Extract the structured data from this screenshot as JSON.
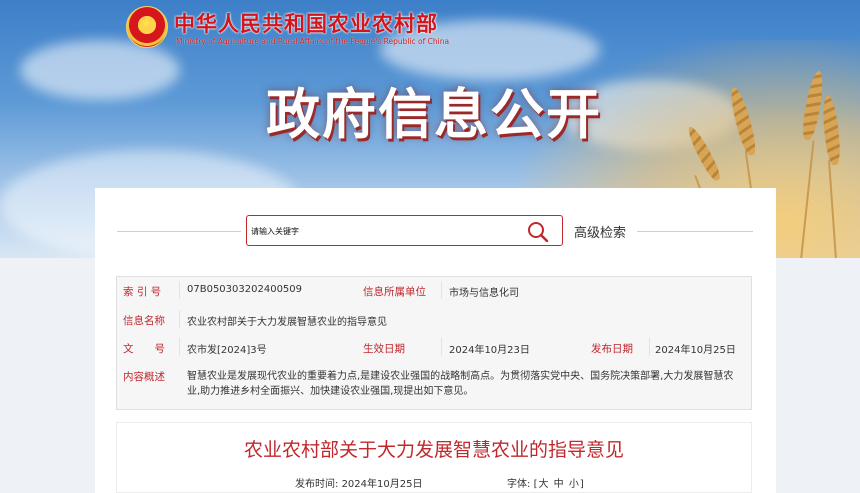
{
  "header": {
    "ministry_name_cn": "中华人民共和国农业农村部",
    "ministry_name_en": "Ministry of Agriculture and Rural Affairs of the People's Republic of China",
    "banner_title": "政府信息公开"
  },
  "search": {
    "placeholder": "请输入关键字",
    "advanced_label": "高级检索",
    "icon": "search-icon"
  },
  "info": {
    "index_label": "索 引 号",
    "index_value": "07B050303202400509",
    "dept_label": "信息所属单位",
    "dept_value": "市场与信息化司",
    "name_label": "信息名称",
    "name_value": "农业农村部关于大力发展智慧农业的指导意见",
    "doc_label": "文　　号",
    "doc_value": "农市发[2024]3号",
    "effective_label": "生效日期",
    "effective_value": "2024年10月23日",
    "issued_label": "发布日期",
    "issued_value": "2024年10月25日",
    "summary_label": "内容概述",
    "summary_value": "智慧农业是发展现代农业的重要着力点,是建设农业强国的战略制高点。为贯彻落实党中央、国务院决策部署,大力发展智慧农业,助力推进乡村全面振兴、加快建设农业强国,现提出如下意见。"
  },
  "article": {
    "title": "农业农村部关于大力发展智慧农业的指导意见",
    "publish_time_label": "发布时间:",
    "publish_time": "2024年10月25日",
    "font_label": "字体:",
    "font_open": "[",
    "font_large": "大",
    "font_medium": "中",
    "font_small": "小",
    "font_close": "]"
  },
  "colors": {
    "accent": "#c0282d",
    "banner_sky": "#5e9ad6"
  }
}
